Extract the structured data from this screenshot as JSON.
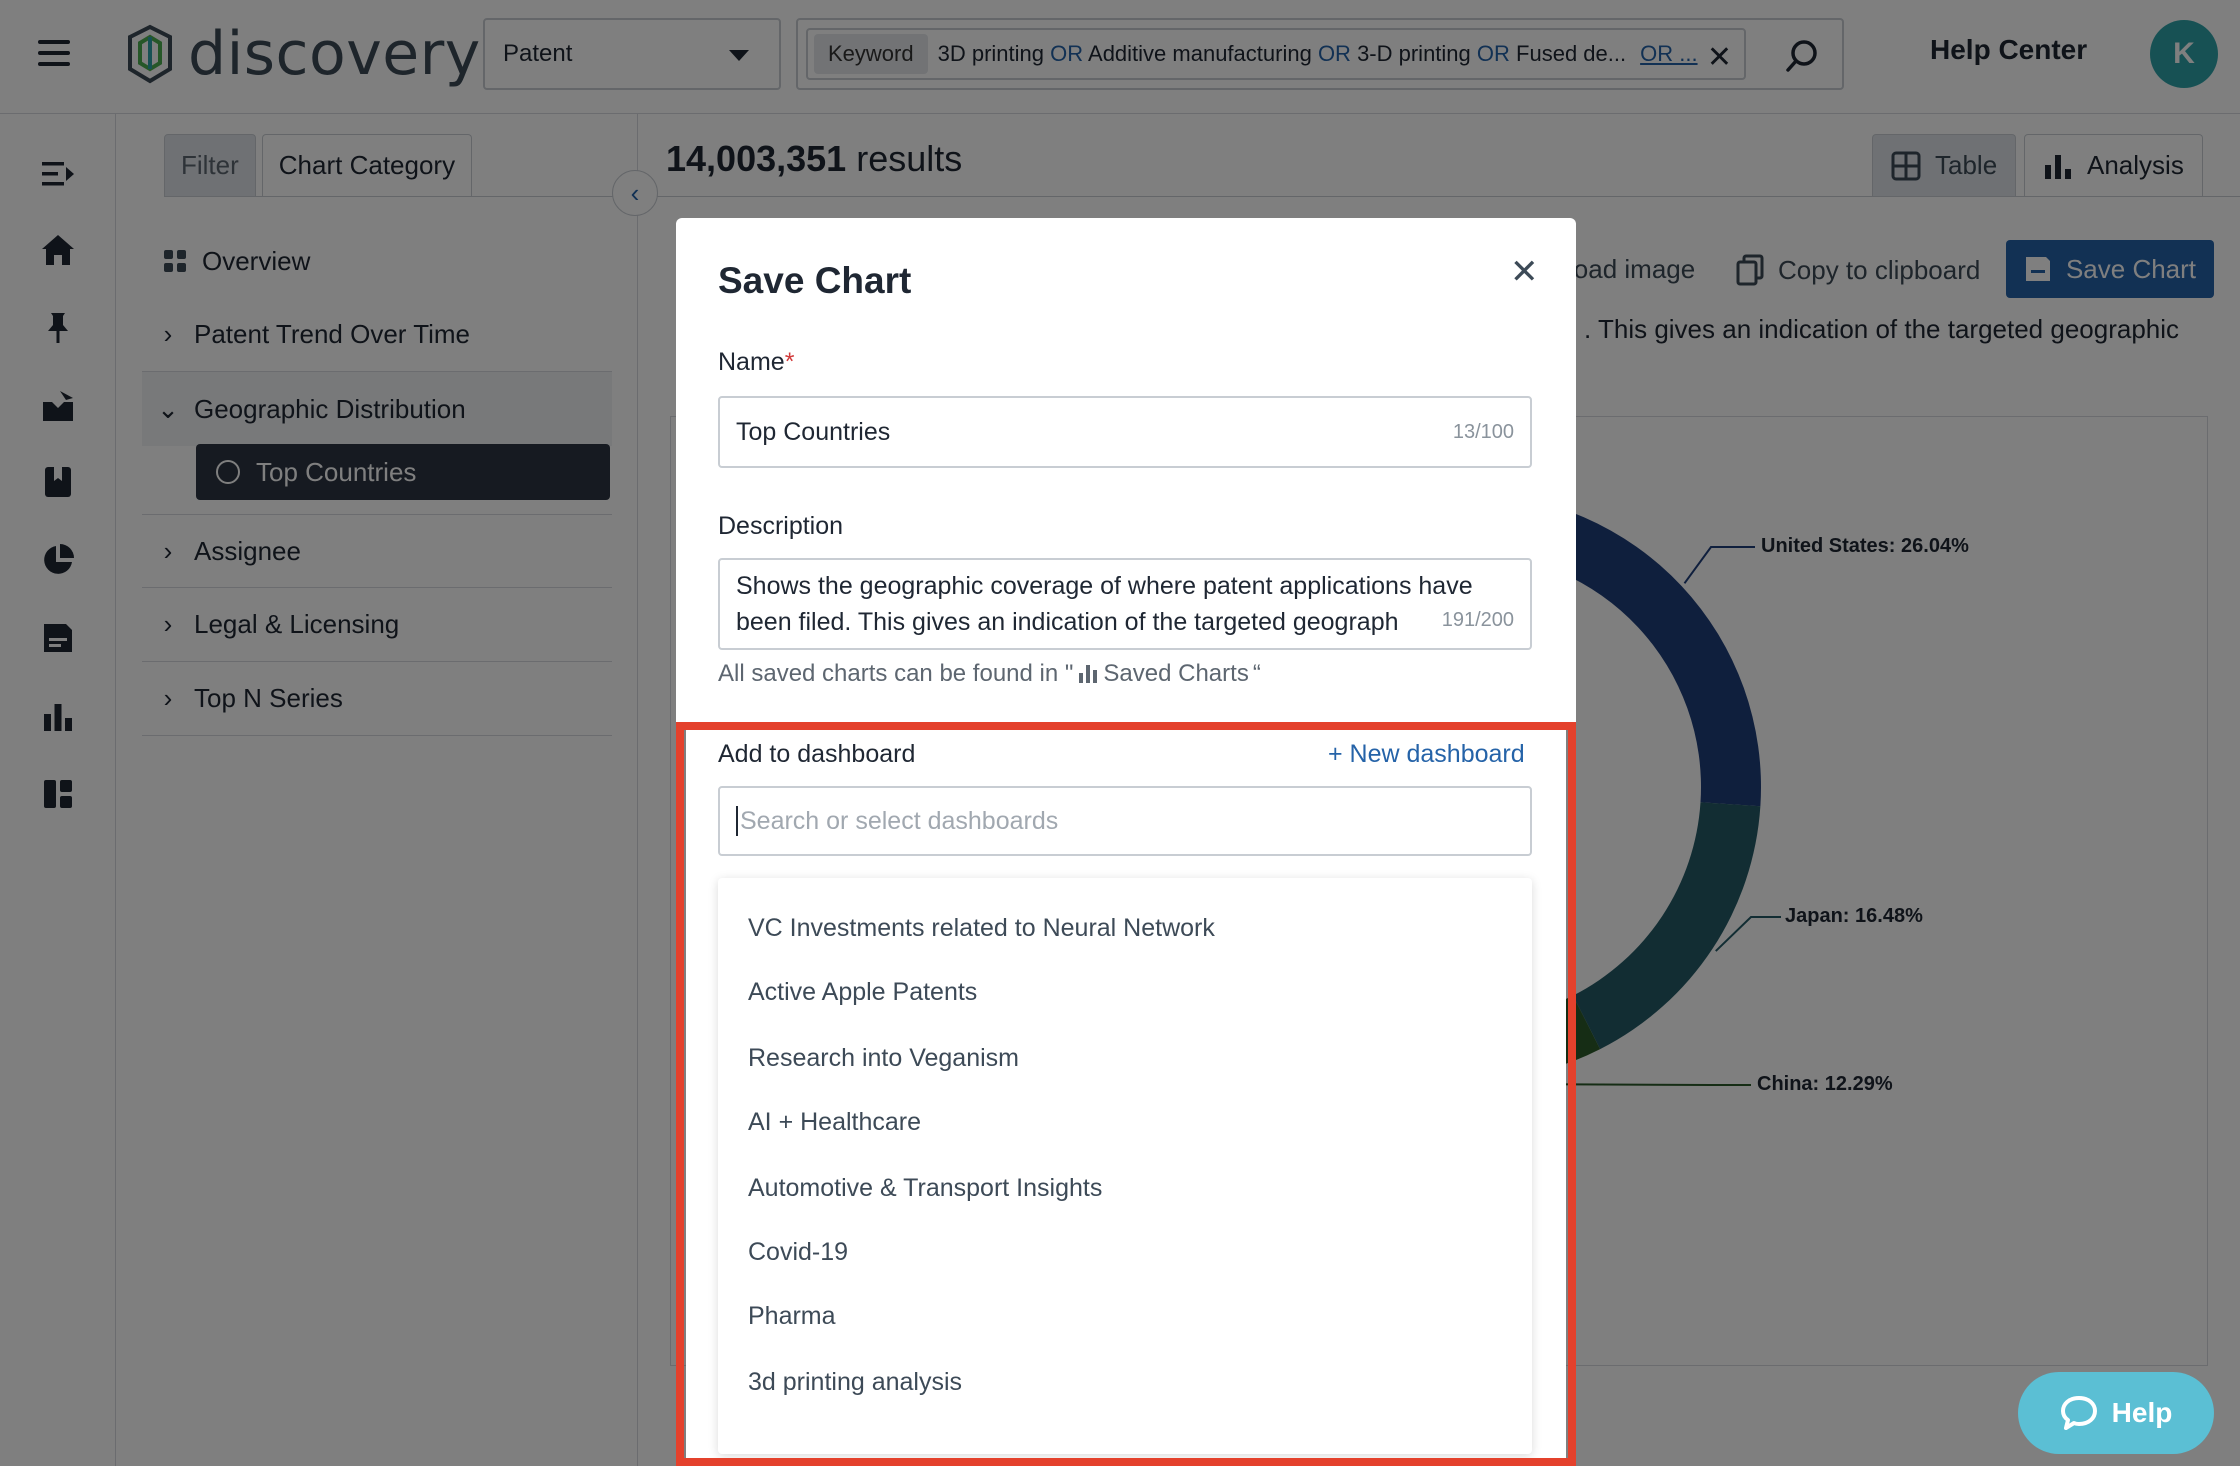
{
  "app": {
    "name": "discovery"
  },
  "topbar": {
    "type_select": "Patent",
    "query": {
      "field": "Keyword",
      "terms": [
        "3D printing",
        "Additive manufacturing",
        "3-D printing",
        "Fused de..."
      ],
      "operator": "OR",
      "more": "OR ..."
    },
    "help_center": "Help Center",
    "avatar_initial": "K"
  },
  "side": {
    "tabs": [
      "Filter",
      "Chart Category"
    ],
    "nav": {
      "overview": "Overview",
      "patent_trend": "Patent Trend Over Time",
      "geographic": "Geographic Distribution",
      "top_countries": "Top Countries",
      "assignee": "Assignee",
      "legal": "Legal & Licensing",
      "top_n": "Top N Series"
    }
  },
  "main": {
    "results_count": "14,003,351",
    "results_label": "results",
    "view_tabs": {
      "table": "Table",
      "analysis": "Analysis"
    },
    "toolbar": {
      "download": "load image",
      "copy": "Copy to clipboard",
      "save": "Save Chart"
    },
    "description_fragment": ". This gives an indication of the targeted geographic"
  },
  "chart_data": {
    "type": "pie",
    "title": "",
    "slices": [
      {
        "label": "United States",
        "value": 26.04,
        "color": "#1f3e7a"
      },
      {
        "label": "Japan",
        "value": 16.48,
        "color": "#255b67"
      },
      {
        "label": "China",
        "value": 12.29,
        "color": "#2d5a2b"
      }
    ],
    "labels_text": [
      "United States: 26.04%",
      "Japan: 16.48%",
      "China: 12.29%"
    ]
  },
  "modal": {
    "title": "Save Chart",
    "name_label": "Name",
    "name_required": "*",
    "name_value": "Top Countries",
    "name_counter": "13/100",
    "description_label": "Description",
    "description_value": "Shows the geographic coverage of where patent applications have been filed. This gives an indication of the targeted geograph",
    "description_counter": "191/200",
    "saved_note_prefix": "All saved charts can be found in \"",
    "saved_note_link": "Saved Charts",
    "saved_note_suffix": "“",
    "add_to_dashboard": "Add to dashboard",
    "new_dashboard": "+ New dashboard",
    "dashboard_search_placeholder": "Search or select dashboards",
    "dashboards": [
      "VC Investments related to Neural Network",
      "Active Apple Patents",
      "Research into Veganism",
      "AI + Healthcare",
      "Automotive & Transport Insights",
      "Covid-19",
      "Pharma",
      "3d printing analysis"
    ]
  },
  "help_button": "Help"
}
